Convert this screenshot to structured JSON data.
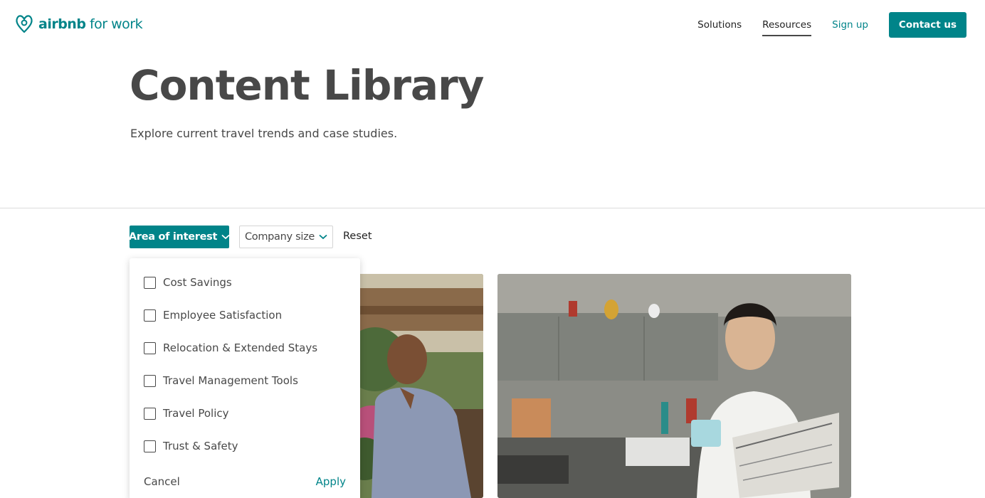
{
  "header": {
    "logo": {
      "brand": "airbnb",
      "suffix": " for work",
      "icon": "airbnb-belo-icon"
    },
    "nav": [
      {
        "label": "Solutions",
        "active": false
      },
      {
        "label": "Resources",
        "active": true
      },
      {
        "label": "Sign up",
        "active": false
      }
    ],
    "cta_label": "Contact us"
  },
  "hero": {
    "title": "Content Library",
    "subtitle": "Explore current travel trends and case studies."
  },
  "filters": {
    "area_of_interest": "Area of interest",
    "company_size": "Company size",
    "reset": "Reset",
    "chevron_icon": "chevron-down-icon"
  },
  "dropdown": {
    "options": [
      {
        "label": "Cost Savings",
        "checked": false
      },
      {
        "label": "Employee Satisfaction",
        "checked": false
      },
      {
        "label": "Relocation & Extended Stays",
        "checked": false
      },
      {
        "label": "Travel Management Tools",
        "checked": false
      },
      {
        "label": "Travel Policy",
        "checked": false
      },
      {
        "label": "Trust & Safety",
        "checked": false
      }
    ],
    "cancel_label": "Cancel",
    "apply_label": "Apply"
  },
  "colors": {
    "accent": "#008489",
    "text": "#484848",
    "divider": "#dcdcdc"
  }
}
